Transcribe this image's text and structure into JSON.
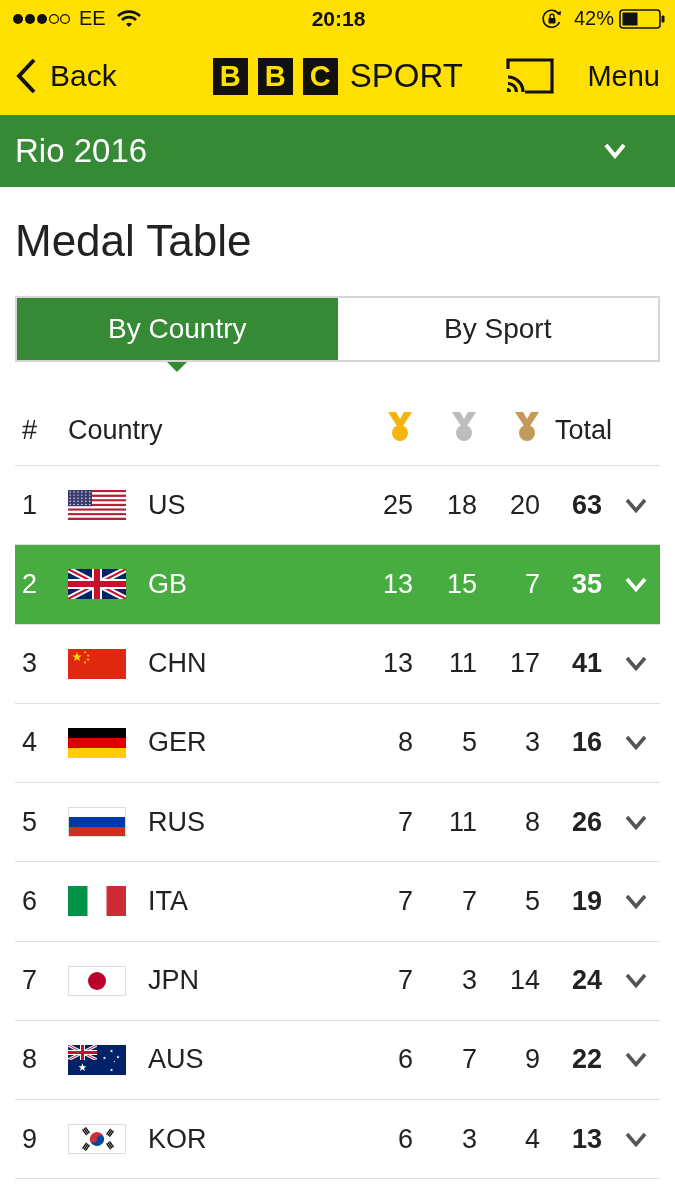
{
  "status_bar": {
    "carrier": "EE",
    "time": "20:18",
    "battery": "42%"
  },
  "nav": {
    "back": "Back",
    "logo_blocks": [
      "B",
      "B",
      "C"
    ],
    "logo_word": "SPORT",
    "menu": "Menu"
  },
  "section": {
    "title": "Rio 2016"
  },
  "page_title": "Medal Table",
  "tabs": [
    {
      "label": "By Country",
      "selected": true
    },
    {
      "label": "By Sport",
      "selected": false
    }
  ],
  "table": {
    "columns": [
      {
        "kind": "text",
        "label": "#"
      },
      {
        "kind": "text",
        "label": "Country"
      },
      {
        "kind": "medal",
        "color": "#f5b50f"
      },
      {
        "kind": "medal",
        "color": "#bdbdbd"
      },
      {
        "kind": "medal",
        "color": "#c49a5a"
      },
      {
        "kind": "text",
        "label": "Total"
      }
    ],
    "rows": [
      {
        "rank": "1",
        "country": "US",
        "gold": "25",
        "silver": "18",
        "bronze": "20",
        "total": "63",
        "selected": false
      },
      {
        "rank": "2",
        "country": "GB",
        "gold": "13",
        "silver": "15",
        "bronze": "7",
        "total": "35",
        "selected": true
      },
      {
        "rank": "3",
        "country": "CHN",
        "gold": "13",
        "silver": "11",
        "bronze": "17",
        "total": "41",
        "selected": false
      },
      {
        "rank": "4",
        "country": "GER",
        "gold": "8",
        "silver": "5",
        "bronze": "3",
        "total": "16",
        "selected": false
      },
      {
        "rank": "5",
        "country": "RUS",
        "gold": "7",
        "silver": "11",
        "bronze": "8",
        "total": "26",
        "selected": false
      },
      {
        "rank": "6",
        "country": "ITA",
        "gold": "7",
        "silver": "7",
        "bronze": "5",
        "total": "19",
        "selected": false
      },
      {
        "rank": "7",
        "country": "JPN",
        "gold": "7",
        "silver": "3",
        "bronze": "14",
        "total": "24",
        "selected": false
      },
      {
        "rank": "8",
        "country": "AUS",
        "gold": "6",
        "silver": "7",
        "bronze": "9",
        "total": "22",
        "selected": false
      },
      {
        "rank": "9",
        "country": "KOR",
        "gold": "6",
        "silver": "3",
        "bronze": "4",
        "total": "13",
        "selected": false
      }
    ]
  }
}
